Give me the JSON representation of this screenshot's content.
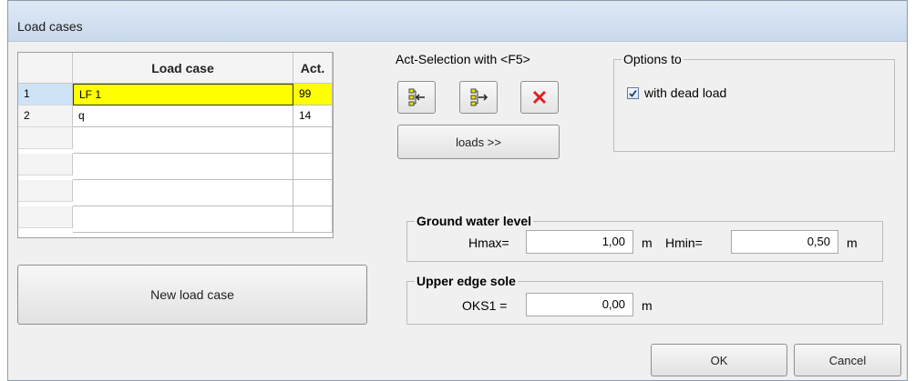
{
  "window": {
    "title": "Load cases"
  },
  "table": {
    "columns": [
      "Load case",
      "Act."
    ],
    "rows": [
      {
        "num": "1",
        "name": "LF 1",
        "act": "99"
      },
      {
        "num": "2",
        "name": "q",
        "act": "14"
      }
    ]
  },
  "buttons": {
    "new_load_case": "New load case",
    "loads": "loads >>",
    "ok": "OK",
    "cancel": "Cancel"
  },
  "act_selection": {
    "label": "Act-Selection with <F5>"
  },
  "options": {
    "title": "Options to",
    "dead_load_label": "with dead load",
    "dead_load_checked": true
  },
  "ground_water": {
    "title": "Ground water level",
    "hmax_label": "Hmax=",
    "hmax_value": "1,00",
    "hmin_label": "Hmin=",
    "hmin_value": "0,50",
    "unit": "m"
  },
  "upper_edge": {
    "title": "Upper edge sole",
    "oks1_label": "OKS1 =",
    "oks1_value": "0,00",
    "unit": "m"
  },
  "colors": {
    "highlight": "#ffff00",
    "delete_red": "#e02020"
  }
}
